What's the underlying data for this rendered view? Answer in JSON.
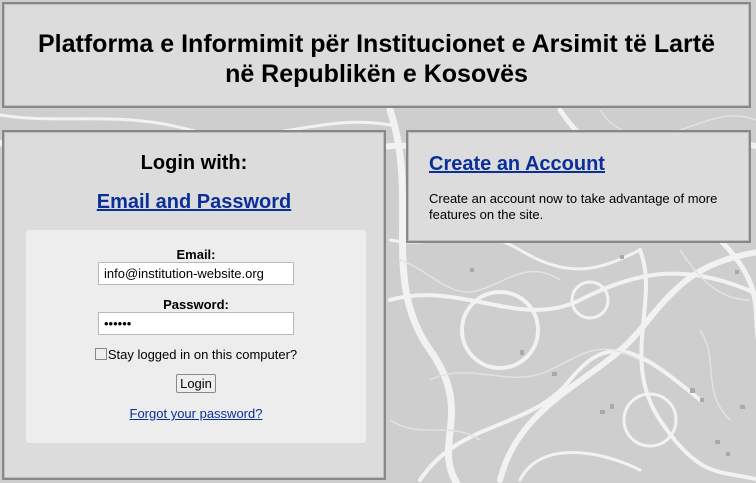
{
  "header": {
    "title_line1": "Platforma e Informimit për Institucionet e Arsimit të Lartë",
    "title_line2": "në Republikën e Kosovës"
  },
  "login": {
    "heading": "Login with:",
    "method_link": "Email and Password",
    "email_label": "Email:",
    "email_value": "info@institution-website.org",
    "password_label": "Password:",
    "password_value": "••••••",
    "stay_logged_label": "Stay logged in on this computer?",
    "stay_logged_checked": false,
    "login_button": "Login",
    "forgot_link": "Forgot your password?"
  },
  "create_account": {
    "link": "Create an Account",
    "description": "Create an account now to take advantage of more features on the site."
  },
  "colors": {
    "panel_bg": "#dcdcdc",
    "panel_border": "#888888",
    "form_bg": "#ededed",
    "link": "#0a2f9a"
  }
}
